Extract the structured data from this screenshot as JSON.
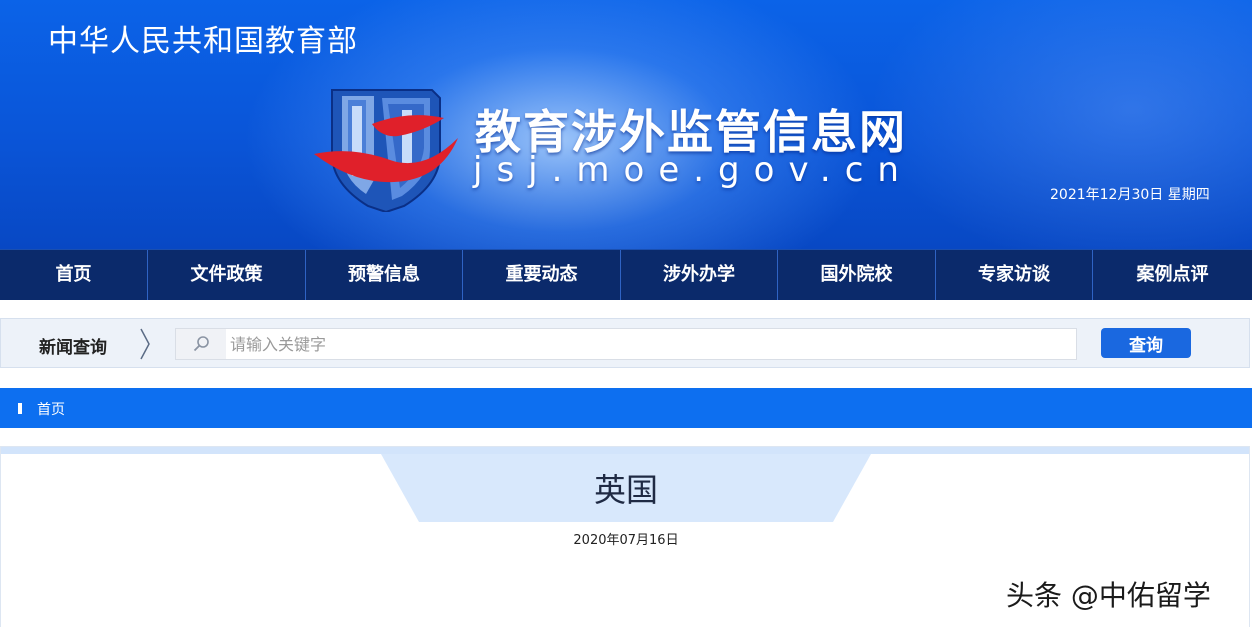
{
  "header": {
    "ministry_name": "中华人民共和国教育部",
    "site_title": "教育涉外监管信息网",
    "site_domain": "jsj.moe.gov.cn",
    "current_date": "2021年12月30日  星期四",
    "logo_icon": "jsj-shield-logo-icon"
  },
  "nav": {
    "items": [
      {
        "label": "首页"
      },
      {
        "label": "文件政策"
      },
      {
        "label": "预警信息"
      },
      {
        "label": "重要动态"
      },
      {
        "label": "涉外办学"
      },
      {
        "label": "国外院校"
      },
      {
        "label": "专家访谈"
      },
      {
        "label": "案例点评"
      }
    ]
  },
  "search": {
    "label": "新闻查询",
    "placeholder": "请输入关键字",
    "value": "",
    "button_label": "查询",
    "icon": "search-icon"
  },
  "breadcrumb": {
    "items": [
      {
        "label": "首页"
      }
    ]
  },
  "article": {
    "title": "英国",
    "date": "2020年07月16日"
  },
  "watermark": {
    "text": "头条 @中佑留学"
  },
  "colors": {
    "banner_blue": "#0a55d8",
    "nav_bg": "#0b2a6b",
    "accent_blue": "#0d6ff0",
    "button_blue": "#1a68e0",
    "logo_red": "#e0202a"
  }
}
